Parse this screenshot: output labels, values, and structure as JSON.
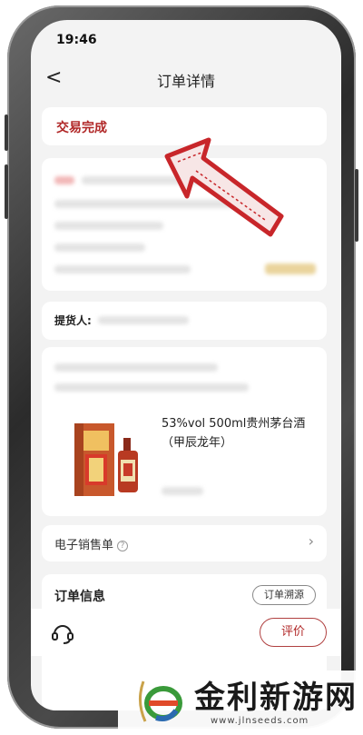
{
  "status_bar": {
    "time": "19:46"
  },
  "header": {
    "back_glyph": "<",
    "title": "订单详情"
  },
  "order_status": {
    "text": "交易完成"
  },
  "pickup": {
    "label": "提货人:"
  },
  "product": {
    "name": "53%vol 500ml贵州茅台酒（甲辰龙年）"
  },
  "receipt": {
    "label": "电子销售单",
    "help_glyph": "?",
    "chevron_glyph": "›"
  },
  "order_info": {
    "label": "订单信息",
    "trace_button": "订单溯源"
  },
  "bottom_bar": {
    "review_button": "评价",
    "service_icon": "headset-icon"
  },
  "watermark": {
    "name": "金利新游网",
    "url": "www.jlnseeds.com"
  },
  "colors": {
    "accent": "#b02626",
    "arrow_red": "#c8262a",
    "background": "#f3f3f3"
  }
}
